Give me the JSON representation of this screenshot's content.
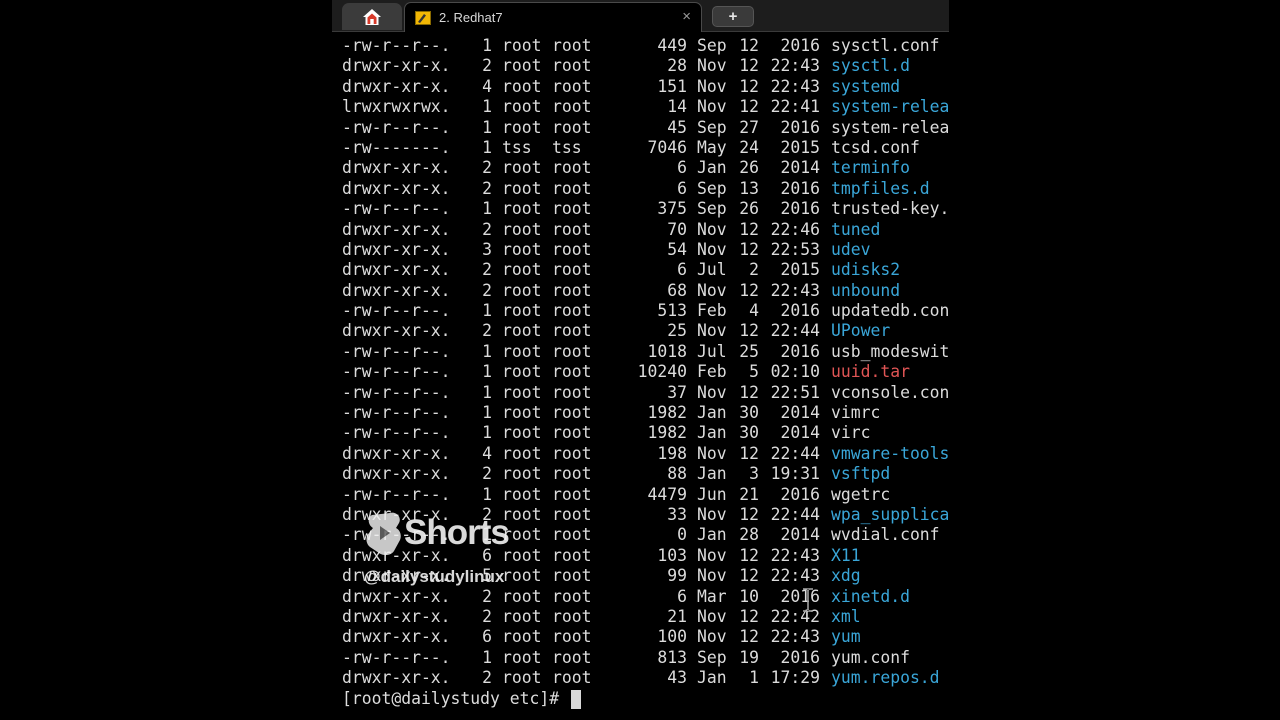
{
  "tabs": {
    "home_icon": "home-icon",
    "terminal_tab_title": "2. Redhat7",
    "close_label": "×",
    "new_tab_label": "+"
  },
  "listing": [
    {
      "perm": "-rw-r--r--.",
      "links": "1",
      "owner": "root",
      "group": "root",
      "size": "449",
      "month": "Sep",
      "day": "12",
      "time": "2016",
      "name": "sysctl.conf",
      "kind": "file"
    },
    {
      "perm": "drwxr-xr-x.",
      "links": "2",
      "owner": "root",
      "group": "root",
      "size": "28",
      "month": "Nov",
      "day": "12",
      "time": "22:43",
      "name": "sysctl.d",
      "kind": "dir"
    },
    {
      "perm": "drwxr-xr-x.",
      "links": "4",
      "owner": "root",
      "group": "root",
      "size": "151",
      "month": "Nov",
      "day": "12",
      "time": "22:43",
      "name": "systemd",
      "kind": "dir"
    },
    {
      "perm": "lrwxrwxrwx.",
      "links": "1",
      "owner": "root",
      "group": "root",
      "size": "14",
      "month": "Nov",
      "day": "12",
      "time": "22:41",
      "name": "system-release",
      "kind": "dir"
    },
    {
      "perm": "-rw-r--r--.",
      "links": "1",
      "owner": "root",
      "group": "root",
      "size": "45",
      "month": "Sep",
      "day": "27",
      "time": "2016",
      "name": "system-release",
      "kind": "file"
    },
    {
      "perm": "-rw-------.",
      "links": "1",
      "owner": "tss",
      "group": "tss",
      "size": "7046",
      "month": "May",
      "day": "24",
      "time": "2015",
      "name": "tcsd.conf",
      "kind": "file"
    },
    {
      "perm": "drwxr-xr-x.",
      "links": "2",
      "owner": "root",
      "group": "root",
      "size": "6",
      "month": "Jan",
      "day": "26",
      "time": "2014",
      "name": "terminfo",
      "kind": "dir"
    },
    {
      "perm": "drwxr-xr-x.",
      "links": "2",
      "owner": "root",
      "group": "root",
      "size": "6",
      "month": "Sep",
      "day": "13",
      "time": "2016",
      "name": "tmpfiles.d",
      "kind": "dir"
    },
    {
      "perm": "-rw-r--r--.",
      "links": "1",
      "owner": "root",
      "group": "root",
      "size": "375",
      "month": "Sep",
      "day": "26",
      "time": "2016",
      "name": "trusted-key.key",
      "kind": "file"
    },
    {
      "perm": "drwxr-xr-x.",
      "links": "2",
      "owner": "root",
      "group": "root",
      "size": "70",
      "month": "Nov",
      "day": "12",
      "time": "22:46",
      "name": "tuned",
      "kind": "dir"
    },
    {
      "perm": "drwxr-xr-x.",
      "links": "3",
      "owner": "root",
      "group": "root",
      "size": "54",
      "month": "Nov",
      "day": "12",
      "time": "22:53",
      "name": "udev",
      "kind": "dir"
    },
    {
      "perm": "drwxr-xr-x.",
      "links": "2",
      "owner": "root",
      "group": "root",
      "size": "6",
      "month": "Jul",
      "day": "2",
      "time": "2015",
      "name": "udisks2",
      "kind": "dir"
    },
    {
      "perm": "drwxr-xr-x.",
      "links": "2",
      "owner": "root",
      "group": "root",
      "size": "68",
      "month": "Nov",
      "day": "12",
      "time": "22:43",
      "name": "unbound",
      "kind": "dir"
    },
    {
      "perm": "-rw-r--r--.",
      "links": "1",
      "owner": "root",
      "group": "root",
      "size": "513",
      "month": "Feb",
      "day": "4",
      "time": "2016",
      "name": "updatedb.conf",
      "kind": "file"
    },
    {
      "perm": "drwxr-xr-x.",
      "links": "2",
      "owner": "root",
      "group": "root",
      "size": "25",
      "month": "Nov",
      "day": "12",
      "time": "22:44",
      "name": "UPower",
      "kind": "dir"
    },
    {
      "perm": "-rw-r--r--.",
      "links": "1",
      "owner": "root",
      "group": "root",
      "size": "1018",
      "month": "Jul",
      "day": "25",
      "time": "2016",
      "name": "usb_modeswitch.conf",
      "kind": "file"
    },
    {
      "perm": "-rw-r--r--.",
      "links": "1",
      "owner": "root",
      "group": "root",
      "size": "10240",
      "month": "Feb",
      "day": "5",
      "time": "02:10",
      "name": "uuid.tar",
      "kind": "archive"
    },
    {
      "perm": "-rw-r--r--.",
      "links": "1",
      "owner": "root",
      "group": "root",
      "size": "37",
      "month": "Nov",
      "day": "12",
      "time": "22:51",
      "name": "vconsole.conf",
      "kind": "file"
    },
    {
      "perm": "-rw-r--r--.",
      "links": "1",
      "owner": "root",
      "group": "root",
      "size": "1982",
      "month": "Jan",
      "day": "30",
      "time": "2014",
      "name": "vimrc",
      "kind": "file"
    },
    {
      "perm": "-rw-r--r--.",
      "links": "1",
      "owner": "root",
      "group": "root",
      "size": "1982",
      "month": "Jan",
      "day": "30",
      "time": "2014",
      "name": "virc",
      "kind": "file"
    },
    {
      "perm": "drwxr-xr-x.",
      "links": "4",
      "owner": "root",
      "group": "root",
      "size": "198",
      "month": "Nov",
      "day": "12",
      "time": "22:44",
      "name": "vmware-tools",
      "kind": "dir"
    },
    {
      "perm": "drwxr-xr-x.",
      "links": "2",
      "owner": "root",
      "group": "root",
      "size": "88",
      "month": "Jan",
      "day": "3",
      "time": "19:31",
      "name": "vsftpd",
      "kind": "dir"
    },
    {
      "perm": "-rw-r--r--.",
      "links": "1",
      "owner": "root",
      "group": "root",
      "size": "4479",
      "month": "Jun",
      "day": "21",
      "time": "2016",
      "name": "wgetrc",
      "kind": "file"
    },
    {
      "perm": "drwxr-xr-x.",
      "links": "2",
      "owner": "root",
      "group": "root",
      "size": "33",
      "month": "Nov",
      "day": "12",
      "time": "22:44",
      "name": "wpa_supplicant",
      "kind": "dir"
    },
    {
      "perm": "-rw-r--r--.",
      "links": "1",
      "owner": "root",
      "group": "root",
      "size": "0",
      "month": "Jan",
      "day": "28",
      "time": "2014",
      "name": "wvdial.conf",
      "kind": "file"
    },
    {
      "perm": "drwxr-xr-x.",
      "links": "6",
      "owner": "root",
      "group": "root",
      "size": "103",
      "month": "Nov",
      "day": "12",
      "time": "22:43",
      "name": "X11",
      "kind": "dir"
    },
    {
      "perm": "drwxr-xr-x.",
      "links": "5",
      "owner": "root",
      "group": "root",
      "size": "99",
      "month": "Nov",
      "day": "12",
      "time": "22:43",
      "name": "xdg",
      "kind": "dir"
    },
    {
      "perm": "drwxr-xr-x.",
      "links": "2",
      "owner": "root",
      "group": "root",
      "size": "6",
      "month": "Mar",
      "day": "10",
      "time": "2016",
      "name": "xinetd.d",
      "kind": "dir"
    },
    {
      "perm": "drwxr-xr-x.",
      "links": "2",
      "owner": "root",
      "group": "root",
      "size": "21",
      "month": "Nov",
      "day": "12",
      "time": "22:42",
      "name": "xml",
      "kind": "dir"
    },
    {
      "perm": "drwxr-xr-x.",
      "links": "6",
      "owner": "root",
      "group": "root",
      "size": "100",
      "month": "Nov",
      "day": "12",
      "time": "22:43",
      "name": "yum",
      "kind": "dir"
    },
    {
      "perm": "-rw-r--r--.",
      "links": "1",
      "owner": "root",
      "group": "root",
      "size": "813",
      "month": "Sep",
      "day": "19",
      "time": "2016",
      "name": "yum.conf",
      "kind": "file"
    },
    {
      "perm": "drwxr-xr-x.",
      "links": "2",
      "owner": "root",
      "group": "root",
      "size": "43",
      "month": "Jan",
      "day": "1",
      "time": "17:29",
      "name": "yum.repos.d",
      "kind": "dir"
    }
  ],
  "prompt": "[root@dailystudy etc]# ",
  "overlay": {
    "shorts_label": "Shorts",
    "handle": "@dailystudylinux"
  },
  "colors": {
    "directory": "#3aa6d8",
    "archive": "#e05555",
    "file": "#dcdcdc",
    "background": "#000000"
  }
}
